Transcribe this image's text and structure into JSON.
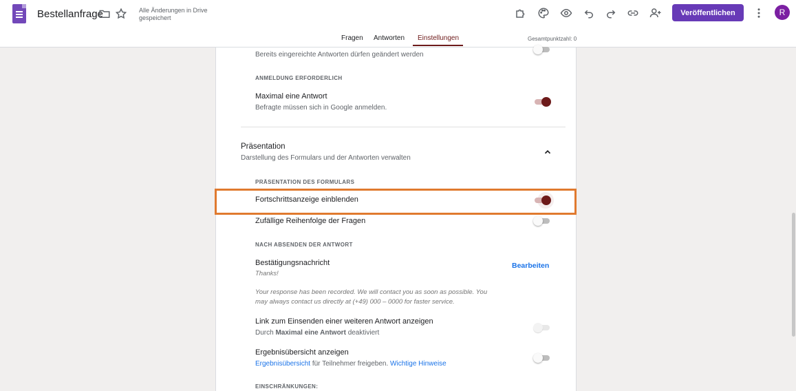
{
  "header": {
    "title": "Bestellanfrage",
    "save_status": "Alle Änderungen in Drive gespeichert",
    "publish_label": "Veröffentlichen",
    "avatar_initial": "R"
  },
  "tabs": {
    "items": [
      "Fragen",
      "Antworten",
      "Einstellungen"
    ],
    "active": "Einstellungen",
    "total_points": "Gesamtpunktzahl: 0"
  },
  "settings": {
    "edit_responses_sub": "Bereits eingereichte Antworten dürfen geändert werden",
    "login_section": "ANMELDUNG ERFORDERLICH",
    "max_one_title": "Maximal eine Antwort",
    "max_one_sub": "Befragte müssen sich in Google anmelden.",
    "presentation_title": "Präsentation",
    "presentation_sub": "Darstellung des Formulars und der Antworten verwalten",
    "form_presentation_section": "PRÄSENTATION DES FORMULARS",
    "progress_bar": "Fortschrittsanzeige einblenden",
    "shuffle": "Zufällige Reihenfolge der Fragen",
    "after_submit_section": "NACH ABSENDEN DER ANTWORT",
    "confirmation_title": "Bestätigungsnachricht",
    "confirmation_edit": "Bearbeiten",
    "confirmation_thanks": "Thanks!",
    "confirmation_message": "Your response has been recorded. We will contact you as soon as possible. You may always contact us directly at (+49) 000 – 0000 for faster service.",
    "another_link_title": "Link zum Einsenden einer weiteren Antwort anzeigen",
    "another_link_prefix": "Durch",
    "another_link_bold": "Maximal eine Antwort",
    "another_link_suffix": "deaktiviert",
    "results_title": "Ergebnisübersicht anzeigen",
    "results_link": "Ergebnisübersicht",
    "results_mid": "für Teilnehmer freigeben.",
    "results_hint_link": "Wichtige Hinweise",
    "restrictions_section": "EINSCHRÄNKUNGEN:"
  },
  "toggles": {
    "edit_responses": false,
    "max_one": true,
    "progress_bar": true,
    "shuffle": false,
    "another_link": false,
    "results": false
  },
  "colors": {
    "accent": "#6d1a1a",
    "publish": "#673ab7",
    "highlight": "#e07a2f",
    "link": "#1a73e8"
  }
}
